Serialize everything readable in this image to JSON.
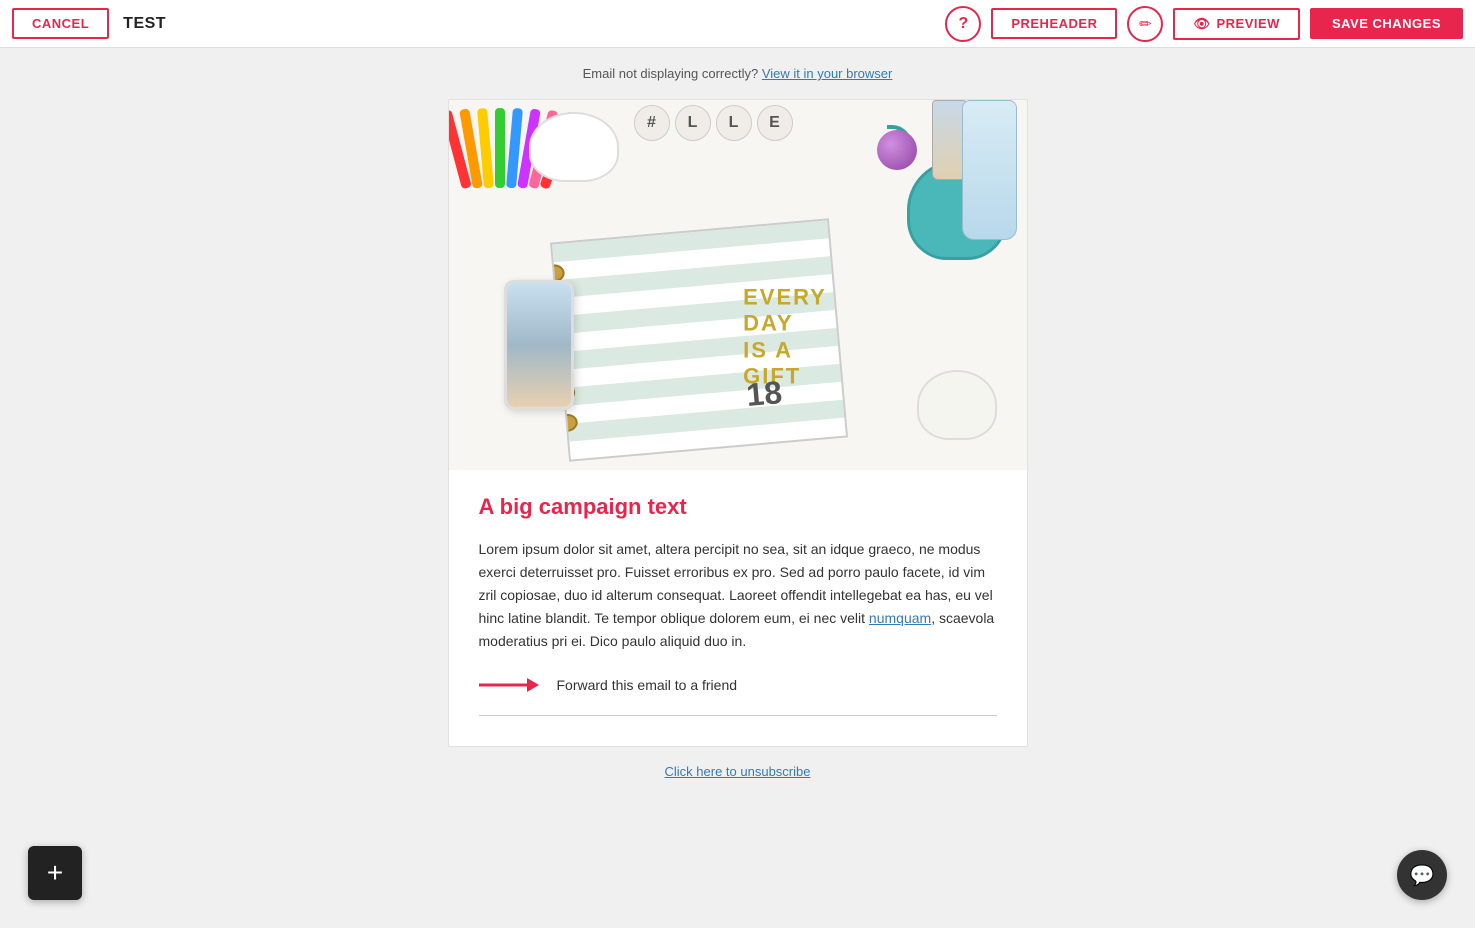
{
  "topbar": {
    "cancel_label": "CANCEL",
    "campaign_name": "TEST",
    "preheader_label": "PREHEADER",
    "preview_label": "PREVIEW",
    "save_label": "SAVE CHANGES",
    "help_icon": "?",
    "pencil_icon": "✎",
    "eye_icon": "👁"
  },
  "email_notice": {
    "text": "Email not displaying correctly?",
    "link_text": "View it in your browser"
  },
  "email_content": {
    "heading": "A big campaign text",
    "body": "Lorem ipsum dolor sit amet, altera percipit no sea, sit an idque graeco, ne modus exerci deterruisset pro. Fuisset erroribus ex pro. Sed ad porro paulo facete, id vim zril copiosae, duo id alterum consequat. Laoreet offendit intellegebat ea has, eu vel hinc latine blandit. Te tempor oblique dolorem eum, ei nec velit ",
    "body_link_text": "numquam",
    "body_end": ", scaevola moderatius pri ei. Dico paulo aliquid duo in.",
    "forward_text": "Forward this email to a friend"
  },
  "footer": {
    "unsubscribe_text": "Click here to unsubscribe"
  },
  "fab": {
    "add_icon": "+",
    "chat_icon": "💬"
  },
  "colors": {
    "primary": "#e8264d",
    "link": "#337ab7"
  }
}
